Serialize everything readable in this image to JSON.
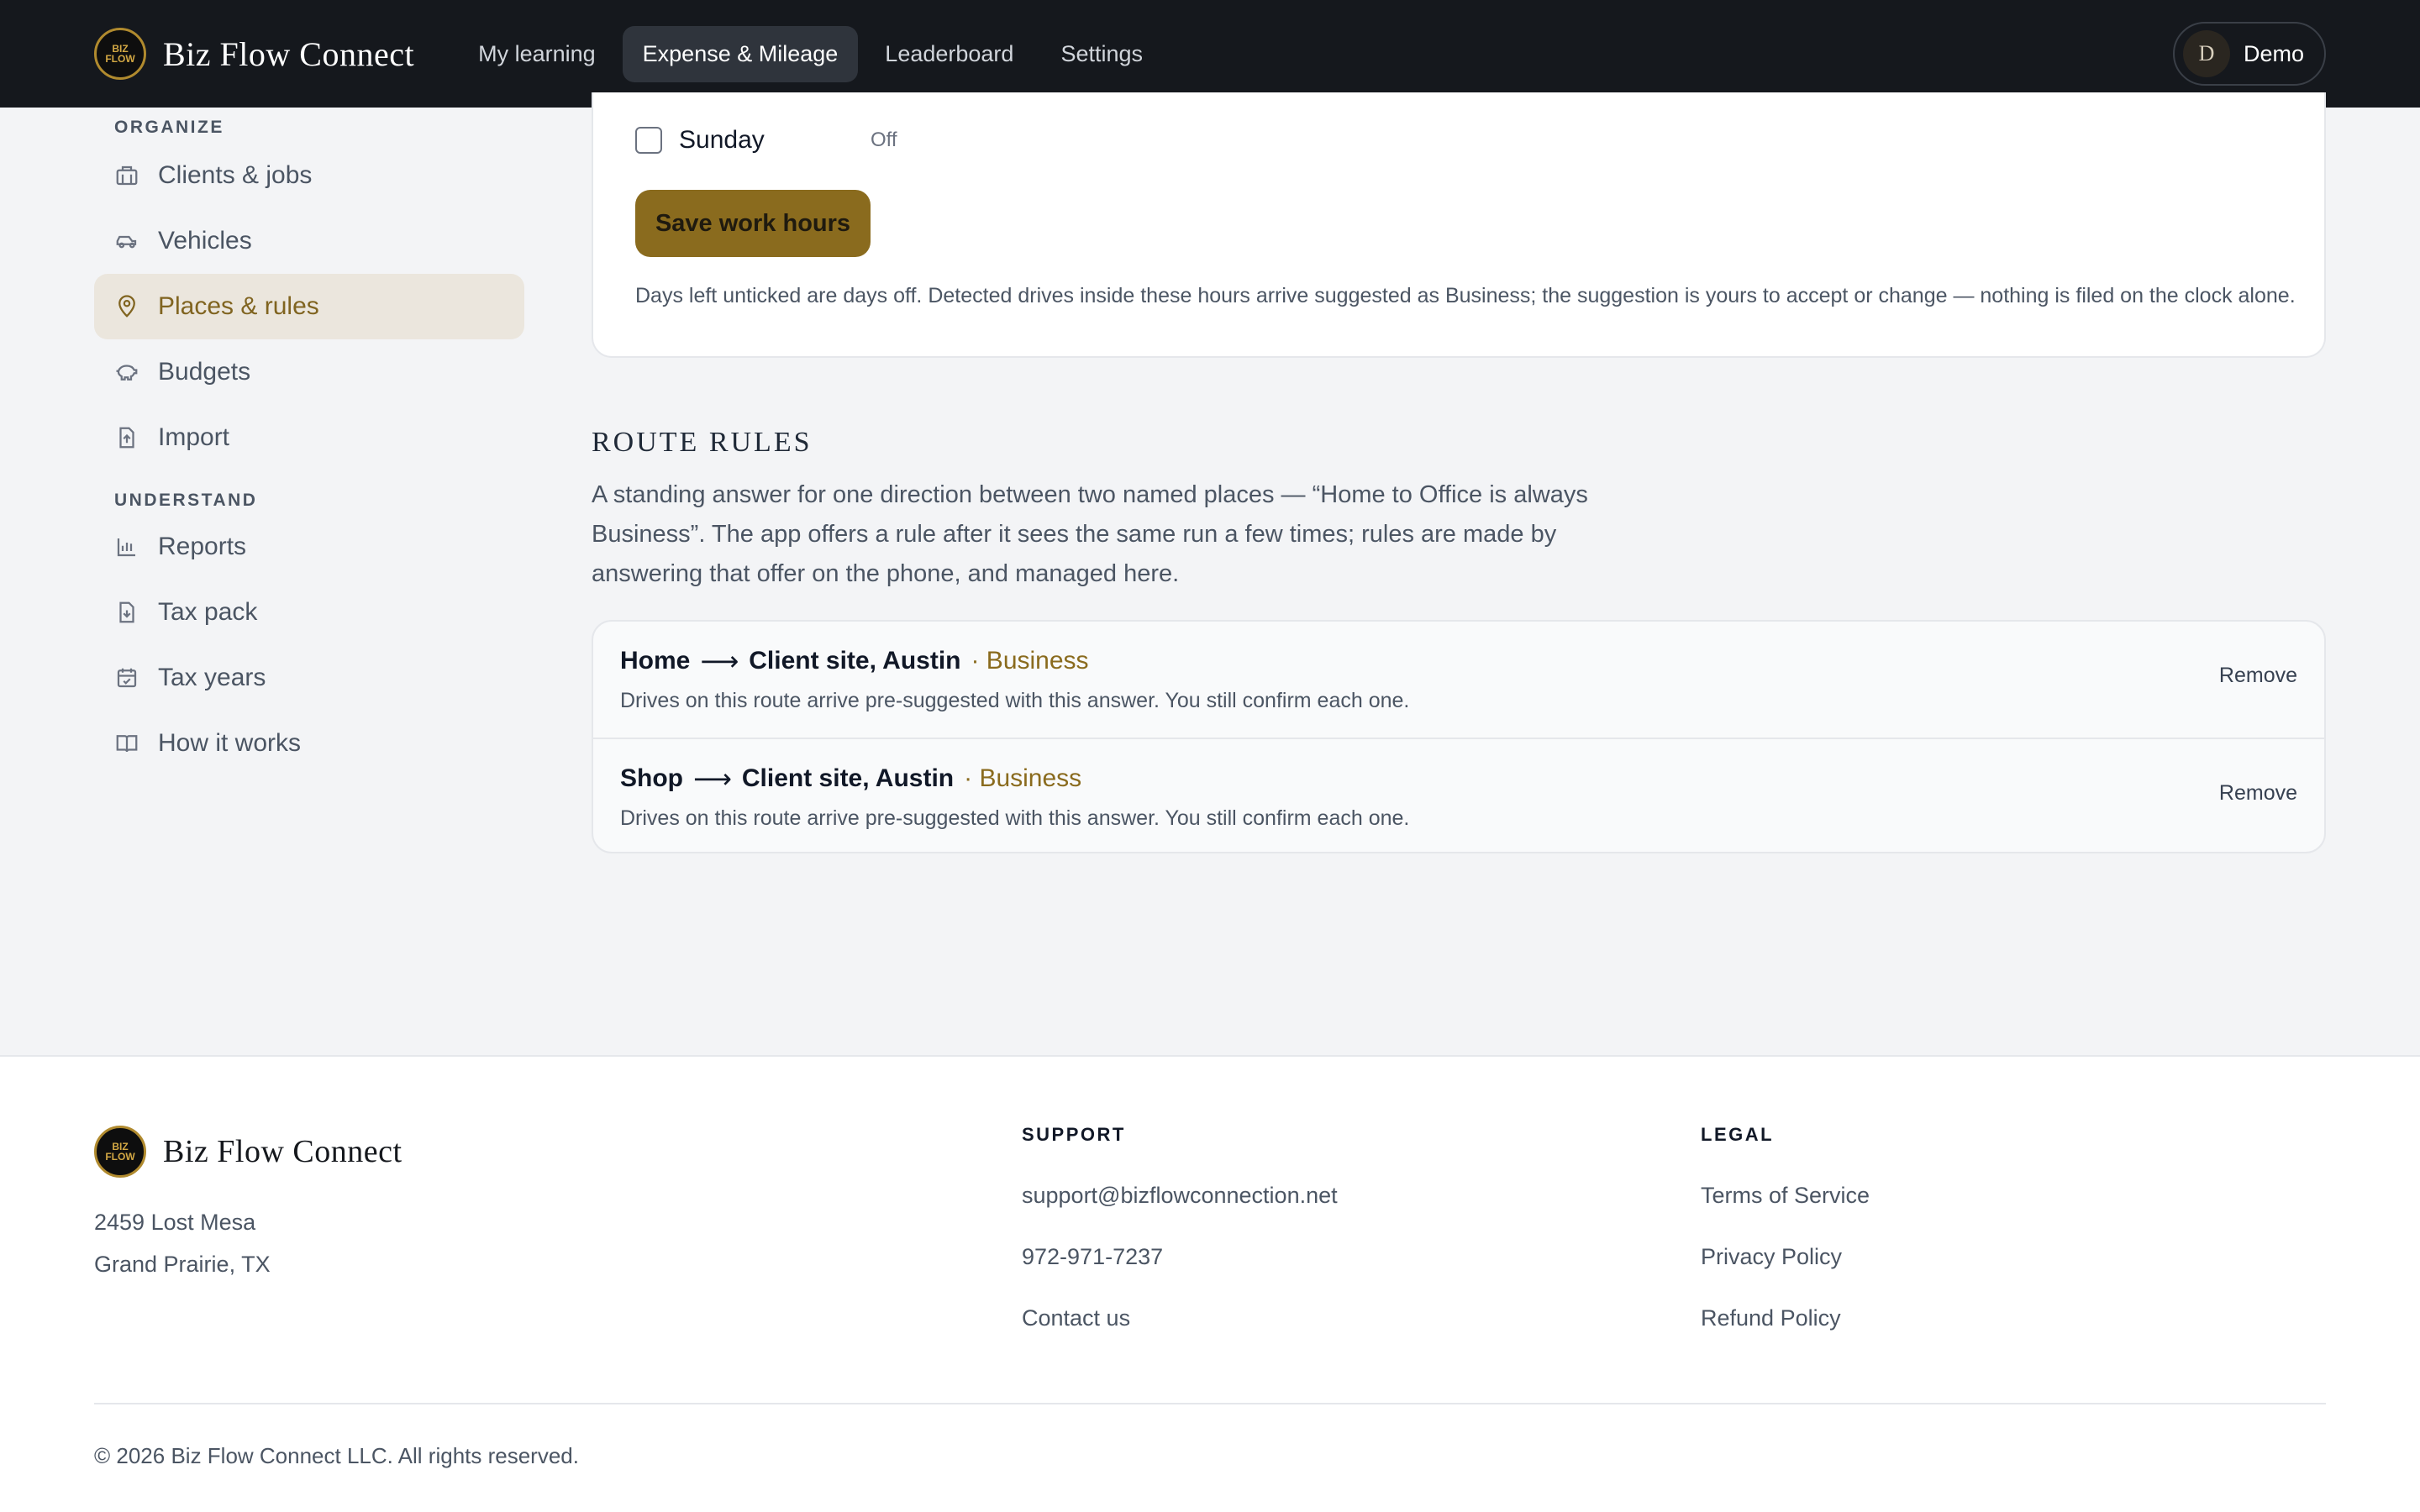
{
  "header": {
    "brand": "Biz Flow Connect",
    "logo_text": "BIZ FLOW",
    "nav": [
      {
        "label": "My learning"
      },
      {
        "label": "Expense & Mileage"
      },
      {
        "label": "Leaderboard"
      },
      {
        "label": "Settings"
      }
    ],
    "user": {
      "initial": "D",
      "name": "Demo"
    }
  },
  "sidebar": {
    "organize_heading": "ORGANIZE",
    "organize": [
      {
        "label": "Clients & jobs",
        "icon": "briefcase-icon"
      },
      {
        "label": "Vehicles",
        "icon": "car-icon"
      },
      {
        "label": "Places & rules",
        "icon": "map-pin-icon"
      },
      {
        "label": "Budgets",
        "icon": "piggy-bank-icon"
      },
      {
        "label": "Import",
        "icon": "file-upload-icon"
      }
    ],
    "understand_heading": "UNDERSTAND",
    "understand": [
      {
        "label": "Reports",
        "icon": "bar-chart-icon"
      },
      {
        "label": "Tax pack",
        "icon": "file-download-icon"
      },
      {
        "label": "Tax years",
        "icon": "calendar-icon"
      },
      {
        "label": "How it works",
        "icon": "book-icon"
      }
    ]
  },
  "work_hours": {
    "day_label": "Sunday",
    "day_status": "Off",
    "save_label": "Save work hours",
    "note": "Days left unticked are days off. Detected drives inside these hours arrive suggested as Business; the suggestion is yours to accept or change — nothing is filed on the clock alone."
  },
  "route_rules": {
    "title": "ROUTE RULES",
    "description": "A standing answer for one direction between two named places — “Home to Office is always Business”. The app offers a rule after it sees the same run a few times; rules are made by answering that offer on the phone, and managed here.",
    "rules": [
      {
        "from": "Home",
        "to": "Client site, Austin",
        "tag": "· Business",
        "sub": "Drives on this route arrive pre-suggested with this answer. You still confirm each one.",
        "action": "Remove"
      },
      {
        "from": "Shop",
        "to": "Client site, Austin",
        "tag": "· Business",
        "sub": "Drives on this route arrive pre-suggested with this answer. You still confirm each one.",
        "action": "Remove"
      }
    ],
    "arrow": "⟶"
  },
  "footer": {
    "brand": "Biz Flow Connect",
    "address_line1": "2459 Lost Mesa",
    "address_line2": "Grand Prairie, TX",
    "support_heading": "SUPPORT",
    "support_links": [
      "support@bizflowconnection.net",
      "972-971-7237",
      "Contact us"
    ],
    "legal_heading": "LEGAL",
    "legal_links": [
      "Terms of Service",
      "Privacy Policy",
      "Refund Policy"
    ],
    "copyright": "© 2026 Biz Flow Connect LLC. All rights reserved."
  },
  "colors": {
    "accent": "#8a6b1e",
    "nav_bg": "#15181d",
    "active_side_bg": "#ebe6dd"
  }
}
